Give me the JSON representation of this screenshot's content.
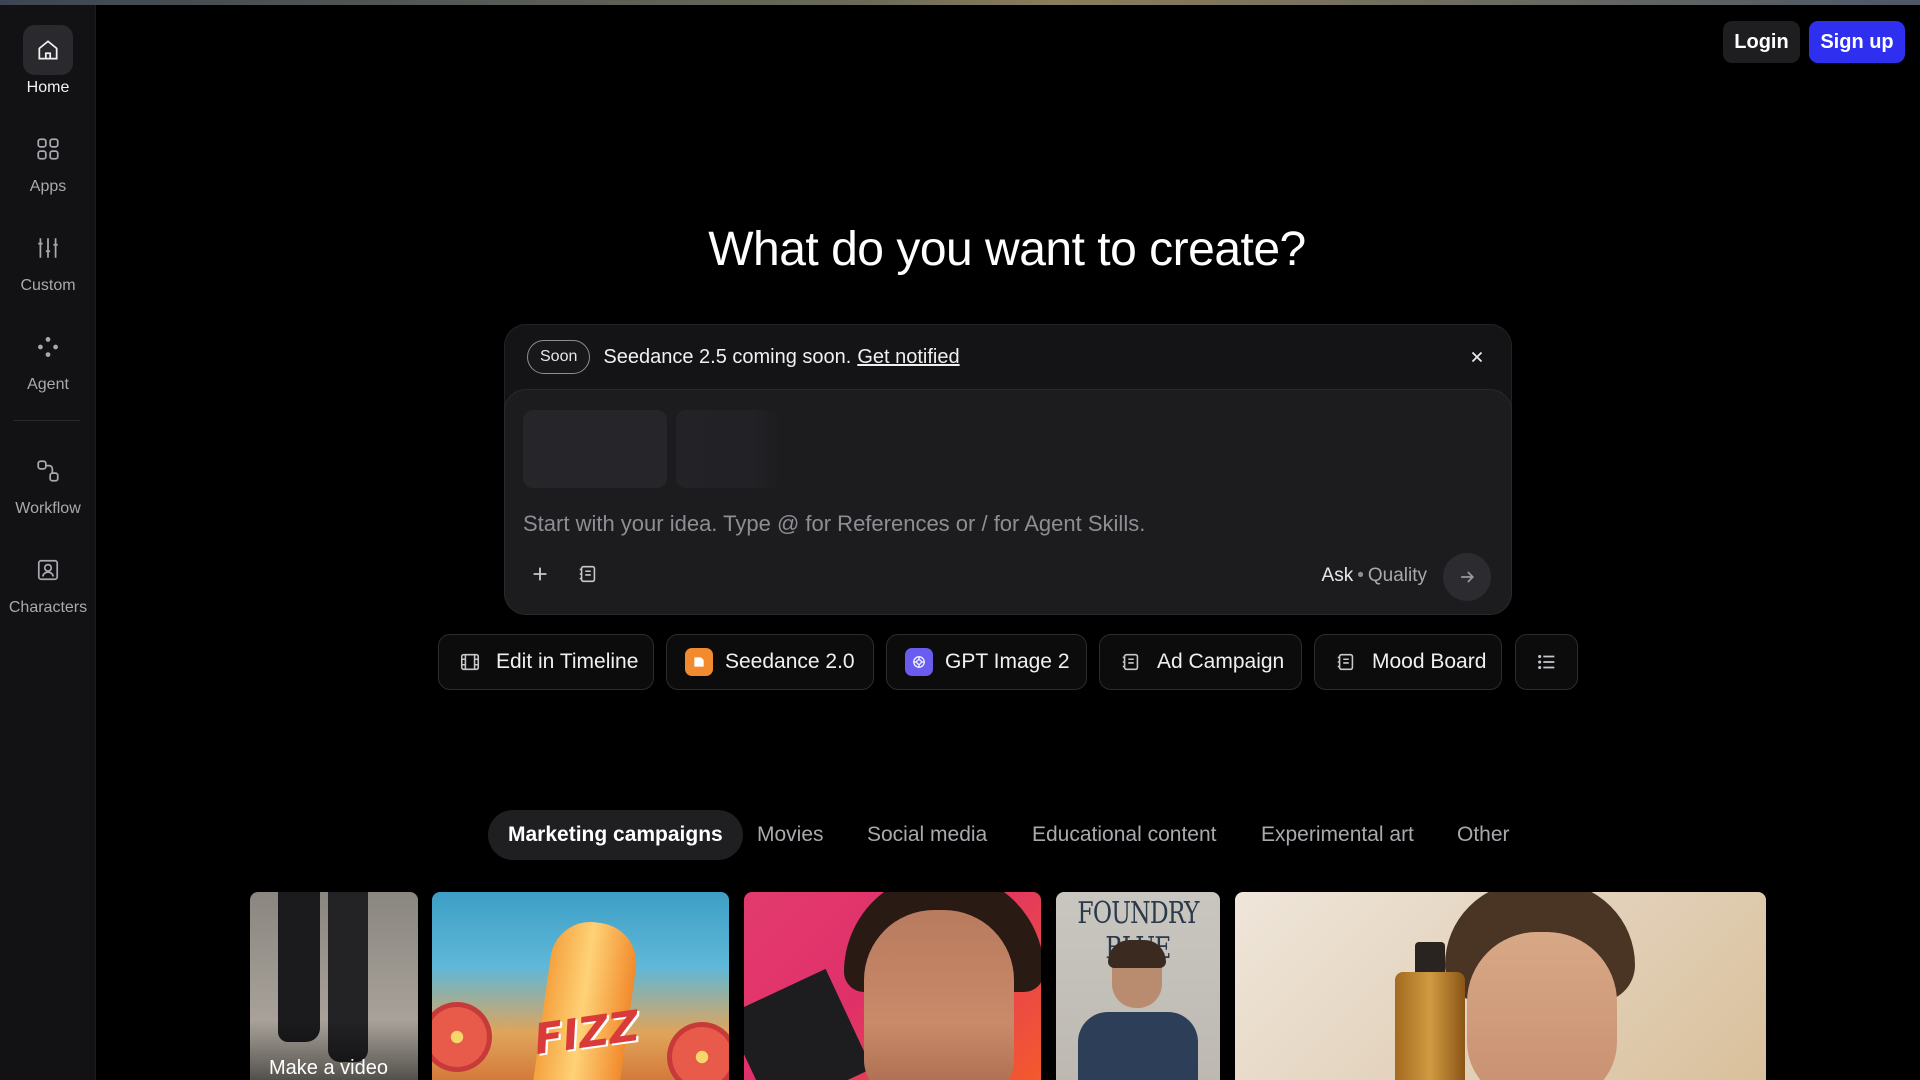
{
  "sidebar": {
    "items": [
      {
        "label": "Home",
        "icon": "home-icon"
      },
      {
        "label": "Apps",
        "icon": "grid-icon"
      },
      {
        "label": "Custom",
        "icon": "sliders-icon"
      },
      {
        "label": "Agent",
        "icon": "agent-dots-icon"
      },
      {
        "label": "Workflow",
        "icon": "workflow-icon"
      },
      {
        "label": "Characters",
        "icon": "character-icon"
      }
    ]
  },
  "auth": {
    "login_label": "Login",
    "signup_label": "Sign up"
  },
  "hero": {
    "title": "What do you want to create?"
  },
  "banner": {
    "badge": "Soon",
    "text": "Seedance 2.5 coming soon.",
    "link": "Get notified"
  },
  "composer": {
    "placeholder": "Start with your idea. Type @ for References or / for Agent Skills.",
    "mode": "Ask",
    "separator": "•",
    "quality": "Quality"
  },
  "chips": [
    {
      "label": "Edit in Timeline",
      "icon": "film-icon"
    },
    {
      "label": "Seedance 2.0",
      "icon": "seedance-icon"
    },
    {
      "label": "GPT Image 2",
      "icon": "openai-icon"
    },
    {
      "label": "Ad Campaign",
      "icon": "template-icon"
    },
    {
      "label": "Mood Board",
      "icon": "template-icon"
    },
    {
      "label": "",
      "icon": "list-icon"
    }
  ],
  "tabs": [
    {
      "label": "Marketing campaigns",
      "active": true
    },
    {
      "label": "Movies"
    },
    {
      "label": "Social media"
    },
    {
      "label": "Educational content"
    },
    {
      "label": "Experimental art"
    },
    {
      "label": "Other"
    }
  ],
  "gallery": {
    "cards": [
      {
        "caption": "Make a video"
      },
      {
        "text": "FIZZ"
      },
      {},
      {
        "text": "FOUNDRY BLUE"
      },
      {}
    ]
  },
  "colors": {
    "accent": "#2f2ff0",
    "background": "#000000",
    "sidebar": "#121214",
    "seedance": "#f28a2e",
    "gpt": "#6b5cf0"
  }
}
